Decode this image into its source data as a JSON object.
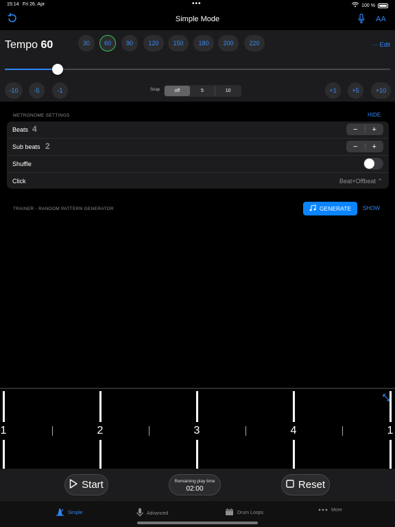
{
  "status": {
    "time": "15:14",
    "date": "Fri 26. Apr",
    "dots": "•••",
    "battery": "100 %"
  },
  "nav": {
    "title": "Simple Mode",
    "aa": "AA"
  },
  "tempo": {
    "label": "Tempo",
    "value": "60",
    "presets": [
      "30",
      "60",
      "90",
      "120",
      "150",
      "180",
      "200",
      "220"
    ],
    "active_preset": "60",
    "edit": "··· Edit",
    "slider_value": 60,
    "slider_min": 30,
    "slider_max": 250,
    "dec_steps": [
      "-10",
      "-5",
      "-1"
    ],
    "inc_steps": [
      "+1",
      "+5",
      "+10"
    ],
    "snap_label": "Snap",
    "snap_options": [
      "off",
      "5",
      "10"
    ],
    "snap_selected": "off"
  },
  "metronome": {
    "title": "METRONOME SETTINGS",
    "hide": "HIDE",
    "beats_label": "Beats",
    "beats_value": "4",
    "subbeats_label": "Sub beats",
    "subbeats_value": "2",
    "shuffle_label": "Shuffle",
    "click_label": "Click",
    "click_value": "Beat+Offbeat ⌃",
    "minus": "−",
    "plus": "+"
  },
  "trainer": {
    "title": "TRAINER - RANDOM PATTERN GENERATOR",
    "generate": "GENERATE",
    "show": "SHOW"
  },
  "beats": {
    "labels": [
      "1",
      "2",
      "3",
      "4",
      "1"
    ]
  },
  "controls": {
    "start": "Start",
    "reset": "Reset",
    "remaining_label": "Remaining play time",
    "remaining_value": "02:00"
  },
  "tabs": [
    {
      "label": "Simple",
      "icon": "metronome-icon"
    },
    {
      "label": "Advanced",
      "icon": "microphone-icon"
    },
    {
      "label": "Drum Loops",
      "icon": "drum-icon"
    },
    {
      "label": "More",
      "icon": "more-dots-icon"
    }
  ],
  "colors": {
    "accent": "#2f86f6",
    "active_ring": "#34c759",
    "panel": "#1c1c1e"
  }
}
